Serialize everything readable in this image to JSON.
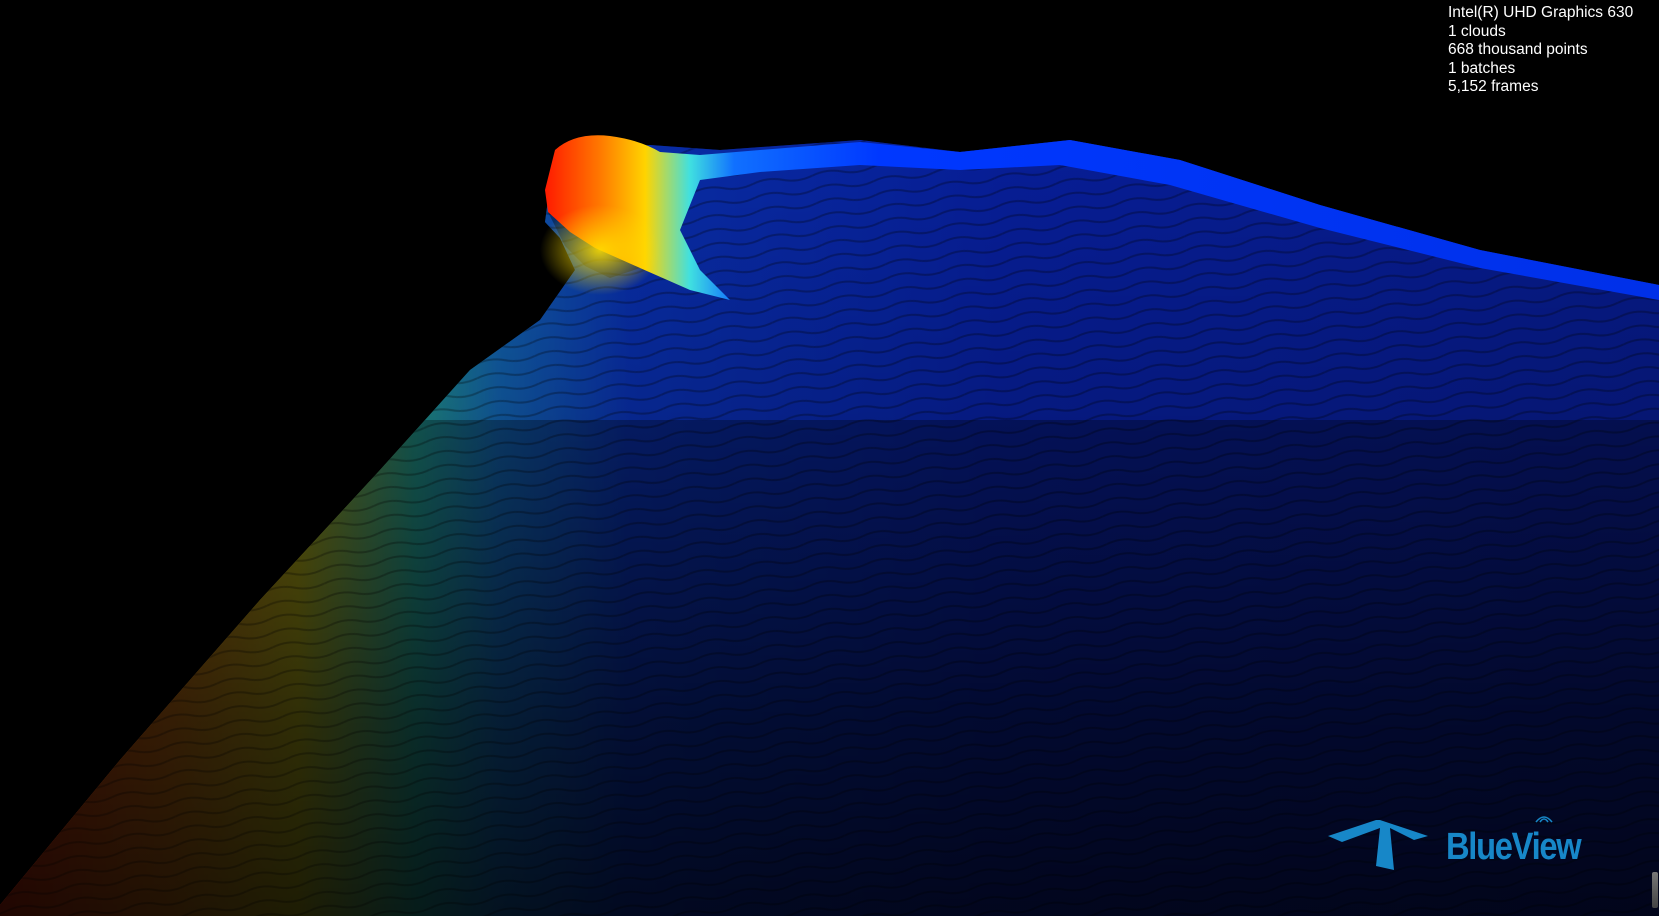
{
  "stats": {
    "gpu": "Intel(R) UHD Graphics 630",
    "clouds": "1 clouds",
    "points": "668 thousand points",
    "batches": "1 batches",
    "frames": "5,152 frames"
  },
  "logo": {
    "wordmark": "BlueView",
    "brand_color": "#1787c8"
  },
  "scene": {
    "background": "#000000",
    "colormap": "jet"
  }
}
